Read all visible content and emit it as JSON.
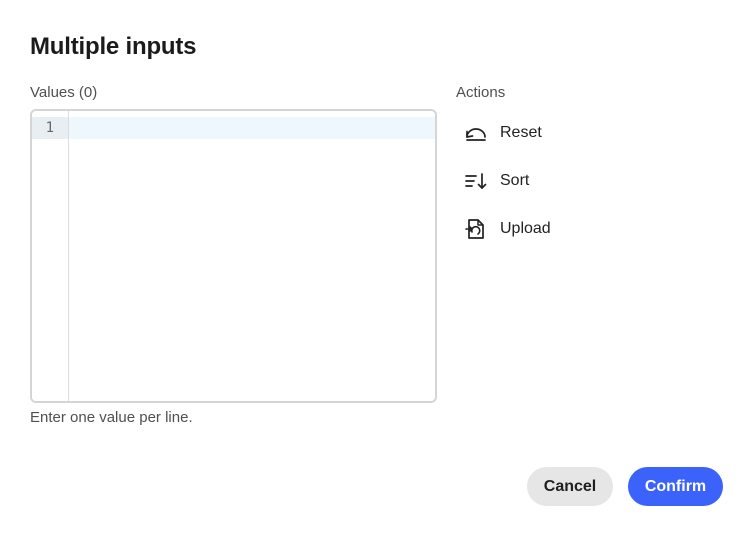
{
  "dialog": {
    "title": "Multiple inputs"
  },
  "values": {
    "label": "Values (0)",
    "line_numbers": [
      "1"
    ],
    "content": "",
    "help_text": "Enter one value per line."
  },
  "actions": {
    "label": "Actions",
    "items": [
      {
        "label": "Reset",
        "icon": "reset-icon"
      },
      {
        "label": "Sort",
        "icon": "sort-icon"
      },
      {
        "label": "Upload",
        "icon": "upload-icon"
      }
    ]
  },
  "footer": {
    "cancel_label": "Cancel",
    "confirm_label": "Confirm"
  },
  "colors": {
    "primary": "#3b63fb",
    "secondary_button": "#e6e6e6",
    "active_line": "#eef7fc"
  }
}
